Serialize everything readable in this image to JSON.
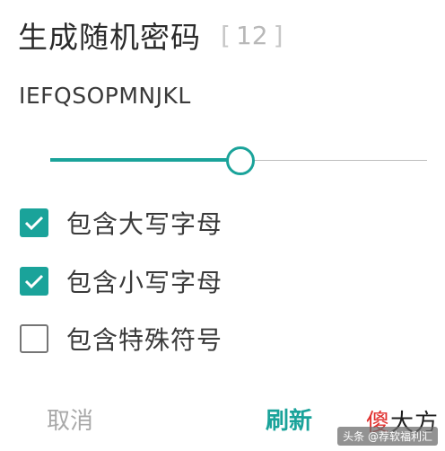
{
  "title": "生成随机密码",
  "length_value": "12",
  "password": "IEFQSOPMNJKL",
  "slider_level": 0.5,
  "options": [
    {
      "label": "包含大写字母",
      "checked": true
    },
    {
      "label": "包含小写字母",
      "checked": true
    },
    {
      "label": "包含特殊符号",
      "checked": false
    }
  ],
  "actions": {
    "cancel_label": "取消",
    "refresh_label": "刷新"
  },
  "watermark": {
    "logo_first_char": "傻",
    "logo_rest": "大方",
    "credit": "头条 @荐软福利汇"
  },
  "colors": {
    "accent": "#1aa39a",
    "text": "#3a3a3a",
    "muted": "#a9a9a9"
  },
  "icons": {
    "checkbox_checked": "checkmark-icon"
  }
}
